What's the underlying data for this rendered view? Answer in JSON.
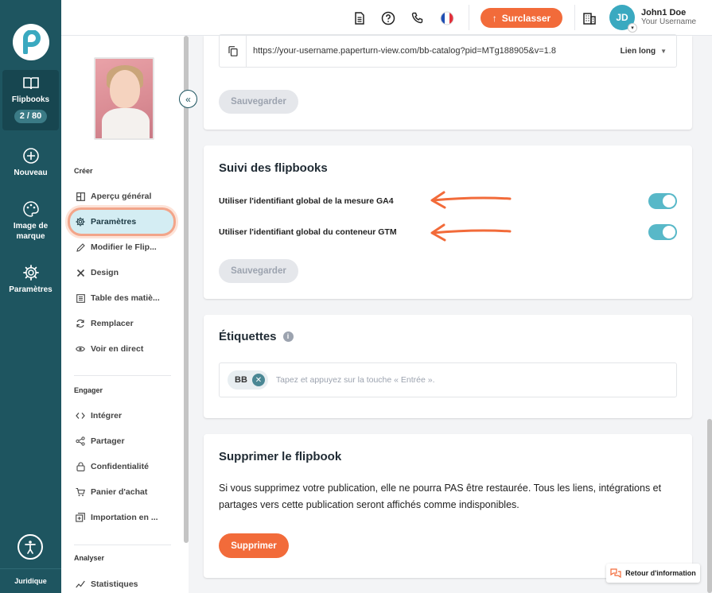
{
  "rail": {
    "items": [
      {
        "label": "Flipbooks",
        "icon": "book-open-icon",
        "count": "2 / 80"
      },
      {
        "label": "Nouveau",
        "icon": "plus-circle-icon"
      },
      {
        "label": "Image de marque",
        "icon": "palette-icon"
      },
      {
        "label": "Paramètres",
        "icon": "gear-icon"
      }
    ],
    "legal": "Juridique"
  },
  "topbar": {
    "upgrade_label": "Surclasser",
    "user_initials": "JD",
    "user_name": "John1 Doe",
    "user_username": "Your Username"
  },
  "sidebar": {
    "sections": {
      "create": "Créer",
      "engage": "Engager",
      "analyze": "Analyser"
    },
    "items": [
      {
        "label": "Aperçu général",
        "icon": "layout-icon"
      },
      {
        "label": "Paramètres",
        "icon": "gear-icon"
      },
      {
        "label": "Modifier le Flip...",
        "icon": "pencil-icon"
      },
      {
        "label": "Design",
        "icon": "design-tools-icon"
      },
      {
        "label": "Table des matiè...",
        "icon": "list-icon"
      },
      {
        "label": "Remplacer",
        "icon": "refresh-icon"
      },
      {
        "label": "Voir en direct",
        "icon": "eye-icon"
      },
      {
        "label": "Intégrer",
        "icon": "code-icon"
      },
      {
        "label": "Partager",
        "icon": "share-icon"
      },
      {
        "label": "Confidentialité",
        "icon": "lock-icon"
      },
      {
        "label": "Panier d'achat",
        "icon": "cart-icon"
      },
      {
        "label": "Importation en ...",
        "icon": "import-icon"
      },
      {
        "label": "Statistiques",
        "icon": "chart-line-icon"
      }
    ]
  },
  "link_card": {
    "url": "https://your-username.paperturn-view.com/bb-catalog?pid=MTg188905&v=1.8",
    "link_type": "Lien long",
    "save_label": "Sauvegarder"
  },
  "tracking_card": {
    "title": "Suivi des flipbooks",
    "ga4_label": "Utiliser l'identifiant global de la mesure GA4",
    "gtm_label": "Utiliser l'identifiant global du conteneur GTM",
    "save_label": "Sauvegarder",
    "accent": "#f26b3a",
    "toggle_color": "#58b8c8"
  },
  "tags_card": {
    "title": "Étiquettes",
    "tag": "BB",
    "placeholder": "Tapez et appuyez sur la touche « Entrée »."
  },
  "delete_card": {
    "title": "Supprimer le flipbook",
    "description": "Si vous supprimez votre publication, elle ne pourra PAS être restaurée. Tous les liens, intégrations et partages vers cette publication seront affichés comme indisponibles.",
    "delete_label": "Supprimer"
  },
  "feedback_label": "Retour d'information"
}
